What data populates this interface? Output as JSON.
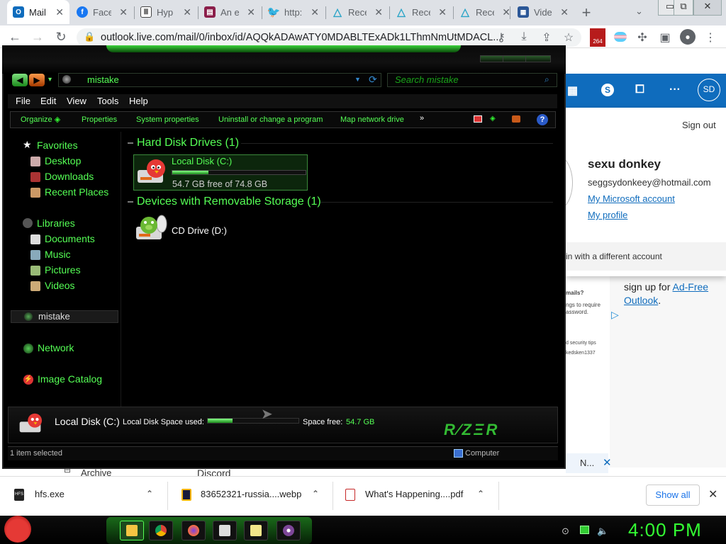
{
  "browser": {
    "tabs": [
      {
        "label": "Mail",
        "icon": "outlook-icon",
        "color": "#0f6cbd",
        "active": true
      },
      {
        "label": "Face",
        "icon": "facebook-icon",
        "color": "#1877f2"
      },
      {
        "label": "Hyp",
        "icon": "museum-icon",
        "color": "#444444"
      },
      {
        "label": "An e",
        "icon": "book-icon",
        "color": "#8b1e4a"
      },
      {
        "label": "http:",
        "icon": "twitter-icon",
        "color": "#1d9bf0"
      },
      {
        "label": "Rece",
        "icon": "triangle-icon",
        "color": "#2aa4c7"
      },
      {
        "label": "Rece",
        "icon": "triangle-icon",
        "color": "#2aa4c7"
      },
      {
        "label": "Rece",
        "icon": "triangle-icon",
        "color": "#2aa4c7"
      },
      {
        "label": "Vide",
        "icon": "grid-icon",
        "color": "#2b5797"
      }
    ],
    "url": "outlook.live.com/mail/0/inbox/id/AQQkADAwATY0MDABLTExADk1LThmNmUtMDACL...",
    "extension_badge": "264"
  },
  "outlook": {
    "account_initials": "SD",
    "sign_out": "Sign out",
    "user_name": "sexu donkey",
    "user_email": "seggsydonkeey@hotmail.com",
    "my_account": "My Microsoft account",
    "my_profile": "My profile",
    "different_account": "in with a different account",
    "ad_text": "sign up for",
    "ad_link_1": "Ad-Free",
    "ad_link_2": "Outlook",
    "ad_punct": ".",
    "side_snip_1": "mails?",
    "side_snip_2": "ngs to require",
    "side_snip_3": "assword.",
    "side_snip_4": "d security tips",
    "side_snip_5": "kedsken1337",
    "archive": "Archive",
    "discord": "Discord",
    "n_button": "N..."
  },
  "explorer": {
    "address": "mistake",
    "search_placeholder": "Search mistake",
    "menu": [
      "File",
      "Edit",
      "View",
      "Tools",
      "Help"
    ],
    "commands": [
      "Organize",
      "Properties",
      "System properties",
      "Uninstall or change a program",
      "Map network drive"
    ],
    "more": "»",
    "nav": {
      "favorites": "Favorites",
      "desktop": "Desktop",
      "downloads": "Downloads",
      "recent": "Recent Places",
      "libraries": "Libraries",
      "documents": "Documents",
      "music": "Music",
      "pictures": "Pictures",
      "videos": "Videos",
      "current": "mistake",
      "network": "Network",
      "image_catalog": "Image Catalog"
    },
    "groups": {
      "hdd": "Hard Disk Drives (1)",
      "removable": "Devices with Removable Storage (1)"
    },
    "local_disk": {
      "name": "Local Disk (C:)",
      "free_text": "54.7 GB free of 74.8 GB",
      "used_fraction": 0.27
    },
    "cd_drive": "CD Drive (D:)",
    "details": {
      "title": "Local Disk (C:)",
      "used_label": "Local Disk Space used:",
      "free_label": "Space free:",
      "free_value": "54.7 GB",
      "brand": "RAZER"
    },
    "status": {
      "selected": "1 item selected",
      "location": "Computer"
    }
  },
  "downloads": {
    "items": [
      "hfs.exe",
      "83652321-russia....webp",
      "What's Happening....pdf"
    ],
    "show_all": "Show all"
  },
  "taskbar": {
    "clock": "4:00 PM"
  },
  "colors": {
    "accent_green": "#33ff33",
    "outlook_blue": "#0f6cbd"
  }
}
